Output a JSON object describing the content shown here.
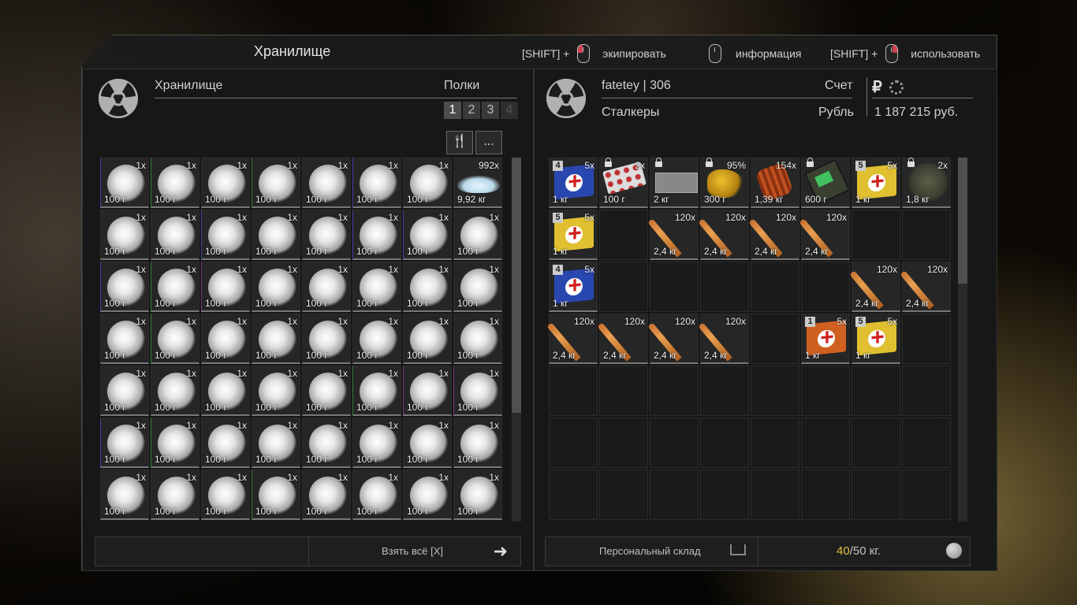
{
  "header": {
    "title": "Хранилище",
    "hints": [
      {
        "prefix": "[SHIFT] +",
        "action": "экипировать",
        "button": "left"
      },
      {
        "prefix": "",
        "action": "информация",
        "button": "none"
      },
      {
        "prefix": "[SHIFT] +",
        "action": "использовать",
        "button": "left"
      }
    ]
  },
  "left_panel": {
    "name": "Хранилище",
    "shelves_label": "Полки",
    "shelves": [
      "1",
      "2",
      "3",
      "4"
    ],
    "active_shelf": "1",
    "tools": {
      "sort_icon": "fork-knife-icon",
      "more_label": "..."
    },
    "take_all_label": "Взять всё [X]"
  },
  "right_panel": {
    "player": "fatetey",
    "level": "306",
    "faction": "Сталкеры",
    "account_label": "Счет",
    "currency_label": "Рубль",
    "balance": "1 187 215 руб.",
    "storage_label": "Персональный склад",
    "weight_current": "40",
    "weight_max": "/50 кг."
  },
  "left_items": [
    [
      {
        "c": "1x",
        "w": "100 г",
        "t": "sphere",
        "r": "bb"
      },
      {
        "c": "1x",
        "w": "100 г",
        "t": "sphere",
        "r": "bg"
      },
      {
        "c": "1x",
        "w": "100 г",
        "t": "sphere"
      },
      {
        "c": "1x",
        "w": "100 г",
        "t": "sphere",
        "r": "bg"
      },
      {
        "c": "1x",
        "w": "100 г",
        "t": "sphere"
      },
      {
        "c": "1x",
        "w": "100 г",
        "t": "sphere",
        "r": "bb"
      },
      {
        "c": "1x",
        "w": "100 г",
        "t": "sphere"
      },
      {
        "c": "992x",
        "w": "9,92 кг",
        "t": "pile"
      }
    ],
    [
      {
        "c": "1x",
        "w": "100 г",
        "t": "sphere"
      },
      {
        "c": "1x",
        "w": "100 г",
        "t": "sphere"
      },
      {
        "c": "1x",
        "w": "100 г",
        "t": "sphere",
        "r": "bb"
      },
      {
        "c": "1x",
        "w": "100 г",
        "t": "sphere"
      },
      {
        "c": "1x",
        "w": "100 г",
        "t": "sphere"
      },
      {
        "c": "1x",
        "w": "100 г",
        "t": "sphere",
        "r": "bb"
      },
      {
        "c": "1x",
        "w": "100 г",
        "t": "sphere",
        "r": "bb"
      },
      {
        "c": "1x",
        "w": "100 г",
        "t": "sphere"
      }
    ],
    [
      {
        "c": "1x",
        "w": "100 г",
        "t": "sphere",
        "r": "bb"
      },
      {
        "c": "1x",
        "w": "100 г",
        "t": "sphere",
        "r": "bg"
      },
      {
        "c": "1x",
        "w": "100 г",
        "t": "sphere",
        "r": "bp"
      },
      {
        "c": "1x",
        "w": "100 г",
        "t": "sphere"
      },
      {
        "c": "1x",
        "w": "100 г",
        "t": "sphere"
      },
      {
        "c": "1x",
        "w": "100 г",
        "t": "sphere"
      },
      {
        "c": "1x",
        "w": "100 г",
        "t": "sphere"
      },
      {
        "c": "1x",
        "w": "100 г",
        "t": "sphere"
      }
    ],
    [
      {
        "c": "1x",
        "w": "100 г",
        "t": "sphere"
      },
      {
        "c": "1x",
        "w": "100 г",
        "t": "sphere",
        "r": "bg"
      },
      {
        "c": "1x",
        "w": "100 г",
        "t": "sphere"
      },
      {
        "c": "1x",
        "w": "100 г",
        "t": "sphere"
      },
      {
        "c": "1x",
        "w": "100 г",
        "t": "sphere"
      },
      {
        "c": "1x",
        "w": "100 г",
        "t": "sphere"
      },
      {
        "c": "1x",
        "w": "100 г",
        "t": "sphere"
      },
      {
        "c": "1x",
        "w": "100 г",
        "t": "sphere"
      }
    ],
    [
      {
        "c": "1x",
        "w": "100 г",
        "t": "sphere"
      },
      {
        "c": "1x",
        "w": "100 г",
        "t": "sphere"
      },
      {
        "c": "1x",
        "w": "100 г",
        "t": "sphere"
      },
      {
        "c": "1x",
        "w": "100 г",
        "t": "sphere"
      },
      {
        "c": "1x",
        "w": "100 г",
        "t": "sphere"
      },
      {
        "c": "1x",
        "w": "100 г",
        "t": "sphere",
        "r": "bg"
      },
      {
        "c": "1x",
        "w": "100 г",
        "t": "sphere",
        "r": "bp"
      },
      {
        "c": "1x",
        "w": "100 г",
        "t": "sphere",
        "r": "bp"
      }
    ],
    [
      {
        "c": "1x",
        "w": "100 г",
        "t": "sphere",
        "r": "bb"
      },
      {
        "c": "1x",
        "w": "100 г",
        "t": "sphere",
        "r": "bg"
      },
      {
        "c": "1x",
        "w": "100 г",
        "t": "sphere"
      },
      {
        "c": "1x",
        "w": "100 г",
        "t": "sphere"
      },
      {
        "c": "1x",
        "w": "100 г",
        "t": "sphere"
      },
      {
        "c": "1x",
        "w": "100 г",
        "t": "sphere"
      },
      {
        "c": "1x",
        "w": "100 г",
        "t": "sphere"
      },
      {
        "c": "1x",
        "w": "100 г",
        "t": "sphere"
      }
    ],
    [
      {
        "c": "1x",
        "w": "100 г",
        "t": "sphere"
      },
      {
        "c": "1x",
        "w": "100 г",
        "t": "sphere"
      },
      {
        "c": "1x",
        "w": "100 г",
        "t": "sphere"
      },
      {
        "c": "1x",
        "w": "100 г",
        "t": "sphere",
        "r": "bg"
      },
      {
        "c": "1x",
        "w": "100 г",
        "t": "sphere"
      },
      {
        "c": "1x",
        "w": "100 г",
        "t": "sphere"
      },
      {
        "c": "1x",
        "w": "100 г",
        "t": "sphere"
      },
      {
        "c": "1x",
        "w": "100 г",
        "t": "sphere"
      }
    ]
  ],
  "right_items": [
    [
      {
        "c": "5x",
        "w": "1 кг",
        "t": "medkit blue",
        "l": "4"
      },
      {
        "c": "2x",
        "w": "100 г",
        "t": "pills",
        "k": true
      },
      {
        "c": "",
        "w": "2 кг",
        "t": "plate",
        "k": true
      },
      {
        "c": "95%",
        "w": "300 г",
        "t": "gold",
        "k": true
      },
      {
        "c": "154x",
        "w": "1,39 кг",
        "t": "bundle"
      },
      {
        "c": "",
        "w": "600 г",
        "t": "device",
        "k": true
      },
      {
        "c": "5x",
        "w": "1 кг",
        "t": "medkit yellow",
        "l": "5"
      },
      {
        "c": "2x",
        "w": "1,8 кг",
        "t": "gear",
        "k": true
      }
    ],
    [
      {
        "c": "5x",
        "w": "1 кг",
        "t": "medkit yellow",
        "l": "5"
      },
      {},
      {
        "c": "120x",
        "w": "2,4 кг",
        "t": "bullet"
      },
      {
        "c": "120x",
        "w": "2,4 кг",
        "t": "bullet"
      },
      {
        "c": "120x",
        "w": "2,4 кг",
        "t": "bullet"
      },
      {
        "c": "120x",
        "w": "2,4 кг",
        "t": "bullet"
      },
      {},
      {}
    ],
    [
      {
        "c": "5x",
        "w": "1 кг",
        "t": "medkit blue",
        "l": "4"
      },
      {},
      {},
      {},
      {},
      {},
      {
        "c": "120x",
        "w": "2,4 кг",
        "t": "bullet"
      },
      {
        "c": "120x",
        "w": "2,4 кг",
        "t": "bullet"
      }
    ],
    [
      {
        "c": "120x",
        "w": "2,4 кг",
        "t": "bullet"
      },
      {
        "c": "120x",
        "w": "2,4 кг",
        "t": "bullet"
      },
      {
        "c": "120x",
        "w": "2,4 кг",
        "t": "bullet"
      },
      {
        "c": "120x",
        "w": "2,4 кг",
        "t": "bullet"
      },
      {},
      {
        "c": "5x",
        "w": "1 кг",
        "t": "medkit orange",
        "l": "1"
      },
      {
        "c": "5x",
        "w": "1 кг",
        "t": "medkit yellow",
        "l": "5"
      },
      {}
    ],
    [
      {},
      {},
      {},
      {},
      {},
      {},
      {},
      {}
    ],
    [
      {},
      {},
      {},
      {},
      {},
      {},
      {},
      {}
    ],
    [
      {},
      {},
      {},
      {},
      {},
      {},
      {},
      {}
    ]
  ]
}
